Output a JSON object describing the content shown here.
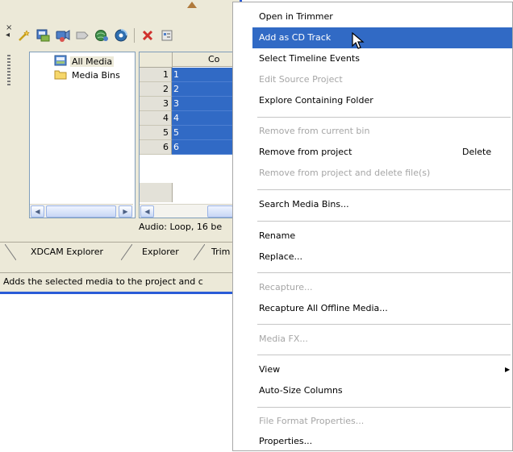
{
  "tree": {
    "items": [
      {
        "label": "All Media",
        "icon": "all-media-icon"
      },
      {
        "label": "Media Bins",
        "icon": "folder-icon"
      }
    ]
  },
  "grid": {
    "column_header": "Co",
    "rows": [
      {
        "num": "1",
        "value": "1"
      },
      {
        "num": "2",
        "value": "2"
      },
      {
        "num": "3",
        "value": "3"
      },
      {
        "num": "4",
        "value": "4"
      },
      {
        "num": "5",
        "value": "5"
      },
      {
        "num": "6",
        "value": "6"
      }
    ]
  },
  "audio_info": "Audio: Loop, 16 be",
  "tabs": [
    "XDCAM Explorer",
    "Explorer",
    "Trim"
  ],
  "status_text": "Adds the selected media to the project and c",
  "menu": {
    "items": [
      {
        "label": "Open in Trimmer",
        "state": "normal"
      },
      {
        "label": "Add as CD Track",
        "state": "highlighted"
      },
      {
        "label": "Select Timeline Events",
        "state": "normal"
      },
      {
        "label": "Edit Source Project",
        "state": "disabled"
      },
      {
        "label": "Explore Containing Folder",
        "state": "normal"
      },
      {
        "label": "Remove from current bin",
        "state": "disabled"
      },
      {
        "label": "Remove from project",
        "state": "normal",
        "shortcut": "Delete"
      },
      {
        "label": "Remove from project and delete file(s)",
        "state": "disabled"
      },
      {
        "label": "Search Media Bins...",
        "state": "normal"
      },
      {
        "label": "Rename",
        "state": "normal"
      },
      {
        "label": "Replace...",
        "state": "normal"
      },
      {
        "label": "Recapture...",
        "state": "disabled"
      },
      {
        "label": "Recapture All Offline Media...",
        "state": "normal"
      },
      {
        "label": "Media FX...",
        "state": "disabled"
      },
      {
        "label": "View",
        "state": "normal",
        "submenu": true
      },
      {
        "label": "Auto-Size Columns",
        "state": "normal"
      },
      {
        "label": "File Format Properties...",
        "state": "disabled"
      },
      {
        "label": "Properties...",
        "state": "normal"
      }
    ]
  },
  "colors": {
    "selection": "#316ac5",
    "window_border": "#2a5bd7",
    "disabled_text": "#a6a6a6",
    "chrome": "#ece9d8"
  }
}
